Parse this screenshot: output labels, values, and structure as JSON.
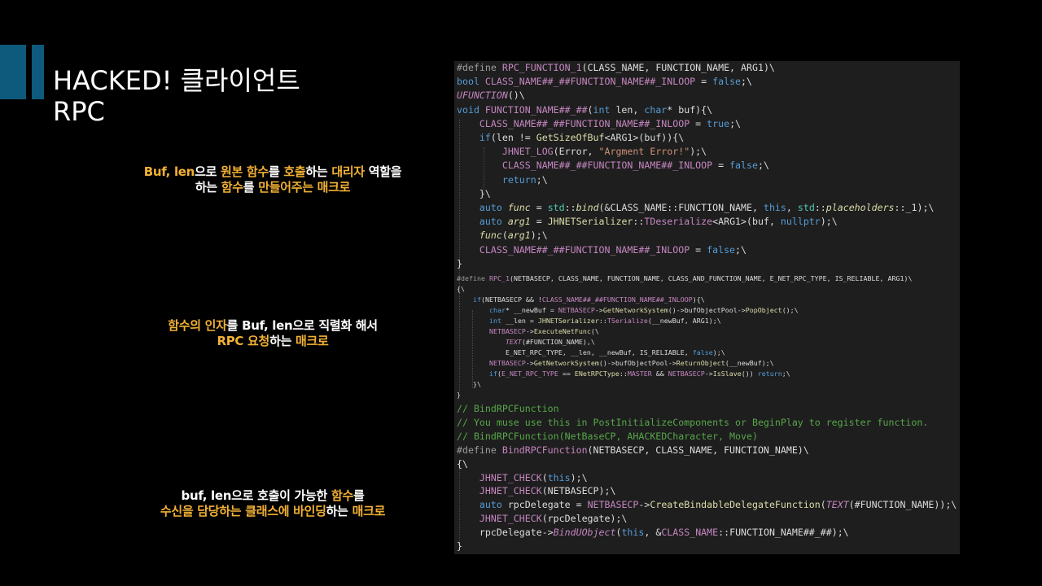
{
  "slide": {
    "title_line1": "HACKED! 클라이언트",
    "title_line2": "RPC"
  },
  "notes": [
    [
      [
        {
          "t": "Buf, len",
          "c": "o"
        },
        {
          "t": "으로 ",
          "c": "w"
        },
        {
          "t": "원본 함수",
          "c": "o"
        },
        {
          "t": "를 ",
          "c": "w"
        },
        {
          "t": "호출",
          "c": "o"
        },
        {
          "t": "하는 ",
          "c": "w"
        },
        {
          "t": "대리자",
          "c": "o"
        },
        {
          "t": " 역할을",
          "c": "w"
        }
      ],
      [
        {
          "t": "하는 ",
          "c": "w"
        },
        {
          "t": "함수",
          "c": "o"
        },
        {
          "t": "를 ",
          "c": "w"
        },
        {
          "t": "만들어주는 매크로",
          "c": "o"
        }
      ]
    ],
    [
      [
        {
          "t": "함수의 인자",
          "c": "o"
        },
        {
          "t": "를 ",
          "c": "w"
        },
        {
          "t": "Buf, len",
          "c": "w"
        },
        {
          "t": "으로 ",
          "c": "w"
        },
        {
          "t": "직렬화",
          "c": "w"
        },
        {
          "t": " 해서",
          "c": "w"
        }
      ],
      [
        {
          "t": "RPC 요청",
          "c": "o"
        },
        {
          "t": "하는 ",
          "c": "w"
        },
        {
          "t": "매크로",
          "c": "o"
        }
      ]
    ],
    [
      [
        {
          "t": "buf, len",
          "c": "w"
        },
        {
          "t": "으로 ",
          "c": "w"
        },
        {
          "t": "호출이 가능한 ",
          "c": "w"
        },
        {
          "t": "함수",
          "c": "o"
        },
        {
          "t": "를",
          "c": "w"
        }
      ],
      [
        {
          "t": "수신을 담당하는 클래스에 바인딩",
          "c": "o"
        },
        {
          "t": "하는 ",
          "c": "w"
        },
        {
          "t": "매크로",
          "c": "o"
        }
      ]
    ]
  ],
  "code_block1": [
    [
      [
        "#define ",
        "def"
      ],
      [
        "RPC_FUNCTION_1",
        "mac"
      ],
      [
        "(CLASS_NAME, FUNCTION_NAME, ARG1)\\",
        "plain"
      ]
    ],
    [
      [
        "bool ",
        "kw"
      ],
      [
        "CLASS_NAME##_##FUNCTION_NAME##_INLOOP",
        "mac"
      ],
      [
        " = ",
        "plain"
      ],
      [
        "false",
        "kw"
      ],
      [
        ";\\",
        "plain"
      ]
    ],
    [
      [
        "UFUNCTION",
        "ct"
      ],
      [
        "()\\",
        "plain"
      ]
    ],
    [
      [
        "void ",
        "kw"
      ],
      [
        "FUNCTION_NAME##_##",
        "mac"
      ],
      [
        "(",
        "plain"
      ],
      [
        "int ",
        "kw"
      ],
      [
        "len, ",
        "plain"
      ],
      [
        "char",
        "kw"
      ],
      [
        "* buf){\\",
        "plain"
      ]
    ],
    [
      [
        "    CLASS_NAME##_##FUNCTION_NAME##_INLOOP",
        "mac"
      ],
      [
        " = ",
        "plain"
      ],
      [
        "true",
        "kw"
      ],
      [
        ";\\",
        "plain"
      ]
    ],
    [
      [
        "    if",
        "kw"
      ],
      [
        "(len != ",
        "plain"
      ],
      [
        "GetSizeOfBuf",
        "fn"
      ],
      [
        "<ARG1>(buf)){\\",
        "plain"
      ]
    ],
    [
      [
        "        JHNET_LOG",
        "mac"
      ],
      [
        "(Error, ",
        "plain"
      ],
      [
        "\"Argment Error!\"",
        "str"
      ],
      [
        ");\\",
        "plain"
      ]
    ],
    [
      [
        "        CLASS_NAME##_##FUNCTION_NAME##_INLOOP",
        "mac"
      ],
      [
        " = ",
        "plain"
      ],
      [
        "false",
        "kw"
      ],
      [
        ";\\",
        "plain"
      ]
    ],
    [
      [
        "        return",
        "kw"
      ],
      [
        ";\\",
        "plain"
      ]
    ],
    [
      [
        "    }\\",
        "plain"
      ]
    ],
    [
      [
        "    auto ",
        "kw"
      ],
      [
        "func",
        "it"
      ],
      [
        " = ",
        "plain"
      ],
      [
        "std",
        "ty"
      ],
      [
        "::",
        "plain"
      ],
      [
        "bind",
        "it"
      ],
      [
        "(&CLASS_NAME::FUNCTION_NAME, ",
        "plain"
      ],
      [
        "this",
        "kw"
      ],
      [
        ", ",
        "plain"
      ],
      [
        "std",
        "ty"
      ],
      [
        "::",
        "plain"
      ],
      [
        "placeholders",
        "it"
      ],
      [
        "::_1);\\",
        "plain"
      ]
    ],
    [
      [
        "    auto ",
        "kw"
      ],
      [
        "arg1",
        "it"
      ],
      [
        " = ",
        "plain"
      ],
      [
        "JHNETSerializer",
        "fn"
      ],
      [
        "::",
        "plain"
      ],
      [
        "TDeserialize",
        "mac"
      ],
      [
        "<ARG1>(buf, ",
        "plain"
      ],
      [
        "nullptr",
        "kw"
      ],
      [
        ");\\",
        "plain"
      ]
    ],
    [
      [
        "    func",
        "it"
      ],
      [
        "(",
        "plain"
      ],
      [
        "arg1",
        "it"
      ],
      [
        ");\\",
        "plain"
      ]
    ],
    [
      [
        "    CLASS_NAME##_##FUNCTION_NAME##_INLOOP",
        "mac"
      ],
      [
        " = ",
        "plain"
      ],
      [
        "false",
        "kw"
      ],
      [
        ";\\",
        "plain"
      ]
    ],
    [
      [
        "}",
        "plain"
      ]
    ]
  ],
  "code_block2": [
    [
      [
        "#define ",
        "def"
      ],
      [
        "RPC_1",
        "mac"
      ],
      [
        "(NETBASECP, CLASS_NAME, FUNCTION_NAME, CLASS_AND_FUNCTION_NAME, E_NET_RPC_TYPE, IS_RELIABLE, ARG1)\\",
        "plain"
      ]
    ],
    [
      [
        "{\\",
        "plain"
      ]
    ],
    [
      [
        "    if",
        "kw"
      ],
      [
        "(NETBASECP && !",
        "plain"
      ],
      [
        "CLASS_NAME##_##FUNCTION_NAME##_INLOOP",
        "mac"
      ],
      [
        "){\\",
        "plain"
      ]
    ],
    [
      [
        "        char",
        "kw"
      ],
      [
        "* __newBuf = ",
        "plain"
      ],
      [
        "NETBASECP",
        "mac"
      ],
      [
        "->",
        "plain"
      ],
      [
        "GetNetworkSystem",
        "fn"
      ],
      [
        "()->bufObjectPool->",
        "plain"
      ],
      [
        "PopObject",
        "fn"
      ],
      [
        "();\\",
        "plain"
      ]
    ],
    [
      [
        "        int ",
        "kw"
      ],
      [
        "__len = ",
        "plain"
      ],
      [
        "JHNETSerializer",
        "fn"
      ],
      [
        "::",
        "plain"
      ],
      [
        "TSerialize",
        "mac"
      ],
      [
        "(__newBuf, ARG1);\\",
        "plain"
      ]
    ],
    [
      [
        "        NETBASECP",
        "mac"
      ],
      [
        "->",
        "plain"
      ],
      [
        "ExecuteNetFunc",
        "fn"
      ],
      [
        "(\\",
        "plain"
      ]
    ],
    [
      [
        "            TEXT",
        "ct"
      ],
      [
        "(#FUNCTION_NAME),\\",
        "plain"
      ]
    ],
    [
      [
        "            E_NET_RPC_TYPE, __len, __newBuf, IS_RELIABLE, ",
        "plain"
      ],
      [
        "false",
        "kw"
      ],
      [
        ");\\",
        "plain"
      ]
    ],
    [
      [
        "        NETBASECP",
        "mac"
      ],
      [
        "->",
        "plain"
      ],
      [
        "GetNetworkSystem",
        "fn"
      ],
      [
        "()->bufObjectPool->",
        "plain"
      ],
      [
        "ReturnObject",
        "fn"
      ],
      [
        "(__newBuf);\\",
        "plain"
      ]
    ],
    [
      [
        "        if",
        "kw"
      ],
      [
        "(",
        "plain"
      ],
      [
        "E_NET_RPC_TYPE",
        "mac"
      ],
      [
        " == ",
        "plain"
      ],
      [
        "ENetRPCType",
        "fn"
      ],
      [
        "::",
        "plain"
      ],
      [
        "MASTER",
        "mac"
      ],
      [
        " && ",
        "plain"
      ],
      [
        "NETBASECP",
        "mac"
      ],
      [
        "->",
        "plain"
      ],
      [
        "IsSlave",
        "fn"
      ],
      [
        "()) ",
        "plain"
      ],
      [
        "return",
        "kw"
      ],
      [
        ";\\",
        "plain"
      ]
    ],
    [
      [
        "    }\\",
        "plain"
      ]
    ],
    [
      [
        "}",
        "plain"
      ]
    ]
  ],
  "code_block3": [
    [
      [
        "// BindRPCFunction",
        "cm"
      ]
    ],
    [
      [
        "// You muse use this in PostInitializeComponents or BeginPlay to register function.",
        "cm"
      ]
    ],
    [
      [
        "// BindRPCFunction(NetBaseCP, AHACKEDCharacter, Move)",
        "cm"
      ]
    ],
    [
      [
        "#define ",
        "def"
      ],
      [
        "BindRPCFunction",
        "mac"
      ],
      [
        "(NETBASECP, CLASS_NAME, FUNCTION_NAME)\\",
        "plain"
      ]
    ],
    [
      [
        "{\\",
        "plain"
      ]
    ],
    [
      [
        "    JHNET_CHECK",
        "mac"
      ],
      [
        "(",
        "plain"
      ],
      [
        "this",
        "kw"
      ],
      [
        ");\\",
        "plain"
      ]
    ],
    [
      [
        "    JHNET_CHECK",
        "mac"
      ],
      [
        "(NETBASECP);\\",
        "plain"
      ]
    ],
    [
      [
        "    auto ",
        "kw"
      ],
      [
        "rpcDelegate = ",
        "plain"
      ],
      [
        "NETBASECP",
        "mac"
      ],
      [
        "->",
        "plain"
      ],
      [
        "CreateBindableDelegateFunction",
        "fn"
      ],
      [
        "(",
        "plain"
      ],
      [
        "TEXT",
        "ct"
      ],
      [
        "(#FUNCTION_NAME));\\",
        "plain"
      ]
    ],
    [
      [
        "    JHNET_CHECK",
        "mac"
      ],
      [
        "(rpcDelegate);\\",
        "plain"
      ]
    ],
    [
      [
        "    rpcDelegate->",
        "plain"
      ],
      [
        "BindUObject",
        "ct"
      ],
      [
        "(",
        "plain"
      ],
      [
        "this",
        "kw"
      ],
      [
        ", &",
        "plain"
      ],
      [
        "CLASS_NAME",
        "mac"
      ],
      [
        "::FUNCTION_NAME##_##);\\",
        "plain"
      ]
    ],
    [
      [
        "}",
        "plain"
      ]
    ]
  ],
  "colors": {
    "background": "#000000",
    "accent_bar": "#0e5a7c",
    "note_orange": "#f2b134",
    "note_white": "#ffffff",
    "code_bg": "#1e1e1e"
  }
}
